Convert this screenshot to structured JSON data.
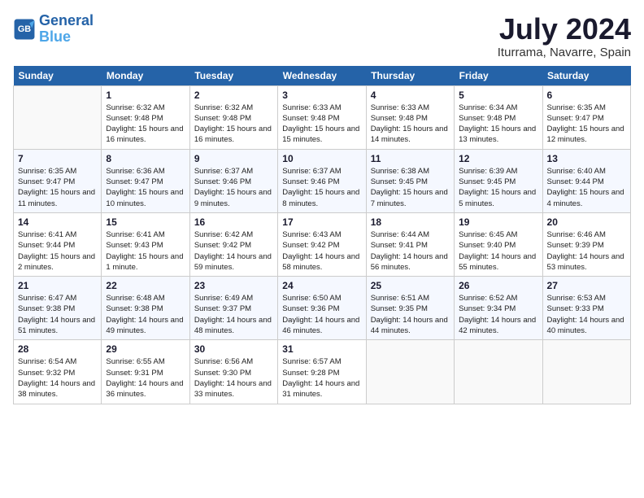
{
  "header": {
    "logo_line1": "General",
    "logo_line2": "Blue",
    "month": "July 2024",
    "location": "Iturrama, Navarre, Spain"
  },
  "days_of_week": [
    "Sunday",
    "Monday",
    "Tuesday",
    "Wednesday",
    "Thursday",
    "Friday",
    "Saturday"
  ],
  "weeks": [
    [
      {
        "date": "",
        "sunrise": "",
        "sunset": "",
        "daylight": ""
      },
      {
        "date": "1",
        "sunrise": "Sunrise: 6:32 AM",
        "sunset": "Sunset: 9:48 PM",
        "daylight": "Daylight: 15 hours and 16 minutes."
      },
      {
        "date": "2",
        "sunrise": "Sunrise: 6:32 AM",
        "sunset": "Sunset: 9:48 PM",
        "daylight": "Daylight: 15 hours and 16 minutes."
      },
      {
        "date": "3",
        "sunrise": "Sunrise: 6:33 AM",
        "sunset": "Sunset: 9:48 PM",
        "daylight": "Daylight: 15 hours and 15 minutes."
      },
      {
        "date": "4",
        "sunrise": "Sunrise: 6:33 AM",
        "sunset": "Sunset: 9:48 PM",
        "daylight": "Daylight: 15 hours and 14 minutes."
      },
      {
        "date": "5",
        "sunrise": "Sunrise: 6:34 AM",
        "sunset": "Sunset: 9:48 PM",
        "daylight": "Daylight: 15 hours and 13 minutes."
      },
      {
        "date": "6",
        "sunrise": "Sunrise: 6:35 AM",
        "sunset": "Sunset: 9:47 PM",
        "daylight": "Daylight: 15 hours and 12 minutes."
      }
    ],
    [
      {
        "date": "7",
        "sunrise": "Sunrise: 6:35 AM",
        "sunset": "Sunset: 9:47 PM",
        "daylight": "Daylight: 15 hours and 11 minutes."
      },
      {
        "date": "8",
        "sunrise": "Sunrise: 6:36 AM",
        "sunset": "Sunset: 9:47 PM",
        "daylight": "Daylight: 15 hours and 10 minutes."
      },
      {
        "date": "9",
        "sunrise": "Sunrise: 6:37 AM",
        "sunset": "Sunset: 9:46 PM",
        "daylight": "Daylight: 15 hours and 9 minutes."
      },
      {
        "date": "10",
        "sunrise": "Sunrise: 6:37 AM",
        "sunset": "Sunset: 9:46 PM",
        "daylight": "Daylight: 15 hours and 8 minutes."
      },
      {
        "date": "11",
        "sunrise": "Sunrise: 6:38 AM",
        "sunset": "Sunset: 9:45 PM",
        "daylight": "Daylight: 15 hours and 7 minutes."
      },
      {
        "date": "12",
        "sunrise": "Sunrise: 6:39 AM",
        "sunset": "Sunset: 9:45 PM",
        "daylight": "Daylight: 15 hours and 5 minutes."
      },
      {
        "date": "13",
        "sunrise": "Sunrise: 6:40 AM",
        "sunset": "Sunset: 9:44 PM",
        "daylight": "Daylight: 15 hours and 4 minutes."
      }
    ],
    [
      {
        "date": "14",
        "sunrise": "Sunrise: 6:41 AM",
        "sunset": "Sunset: 9:44 PM",
        "daylight": "Daylight: 15 hours and 2 minutes."
      },
      {
        "date": "15",
        "sunrise": "Sunrise: 6:41 AM",
        "sunset": "Sunset: 9:43 PM",
        "daylight": "Daylight: 15 hours and 1 minute."
      },
      {
        "date": "16",
        "sunrise": "Sunrise: 6:42 AM",
        "sunset": "Sunset: 9:42 PM",
        "daylight": "Daylight: 14 hours and 59 minutes."
      },
      {
        "date": "17",
        "sunrise": "Sunrise: 6:43 AM",
        "sunset": "Sunset: 9:42 PM",
        "daylight": "Daylight: 14 hours and 58 minutes."
      },
      {
        "date": "18",
        "sunrise": "Sunrise: 6:44 AM",
        "sunset": "Sunset: 9:41 PM",
        "daylight": "Daylight: 14 hours and 56 minutes."
      },
      {
        "date": "19",
        "sunrise": "Sunrise: 6:45 AM",
        "sunset": "Sunset: 9:40 PM",
        "daylight": "Daylight: 14 hours and 55 minutes."
      },
      {
        "date": "20",
        "sunrise": "Sunrise: 6:46 AM",
        "sunset": "Sunset: 9:39 PM",
        "daylight": "Daylight: 14 hours and 53 minutes."
      }
    ],
    [
      {
        "date": "21",
        "sunrise": "Sunrise: 6:47 AM",
        "sunset": "Sunset: 9:38 PM",
        "daylight": "Daylight: 14 hours and 51 minutes."
      },
      {
        "date": "22",
        "sunrise": "Sunrise: 6:48 AM",
        "sunset": "Sunset: 9:38 PM",
        "daylight": "Daylight: 14 hours and 49 minutes."
      },
      {
        "date": "23",
        "sunrise": "Sunrise: 6:49 AM",
        "sunset": "Sunset: 9:37 PM",
        "daylight": "Daylight: 14 hours and 48 minutes."
      },
      {
        "date": "24",
        "sunrise": "Sunrise: 6:50 AM",
        "sunset": "Sunset: 9:36 PM",
        "daylight": "Daylight: 14 hours and 46 minutes."
      },
      {
        "date": "25",
        "sunrise": "Sunrise: 6:51 AM",
        "sunset": "Sunset: 9:35 PM",
        "daylight": "Daylight: 14 hours and 44 minutes."
      },
      {
        "date": "26",
        "sunrise": "Sunrise: 6:52 AM",
        "sunset": "Sunset: 9:34 PM",
        "daylight": "Daylight: 14 hours and 42 minutes."
      },
      {
        "date": "27",
        "sunrise": "Sunrise: 6:53 AM",
        "sunset": "Sunset: 9:33 PM",
        "daylight": "Daylight: 14 hours and 40 minutes."
      }
    ],
    [
      {
        "date": "28",
        "sunrise": "Sunrise: 6:54 AM",
        "sunset": "Sunset: 9:32 PM",
        "daylight": "Daylight: 14 hours and 38 minutes."
      },
      {
        "date": "29",
        "sunrise": "Sunrise: 6:55 AM",
        "sunset": "Sunset: 9:31 PM",
        "daylight": "Daylight: 14 hours and 36 minutes."
      },
      {
        "date": "30",
        "sunrise": "Sunrise: 6:56 AM",
        "sunset": "Sunset: 9:30 PM",
        "daylight": "Daylight: 14 hours and 33 minutes."
      },
      {
        "date": "31",
        "sunrise": "Sunrise: 6:57 AM",
        "sunset": "Sunset: 9:28 PM",
        "daylight": "Daylight: 14 hours and 31 minutes."
      },
      {
        "date": "",
        "sunrise": "",
        "sunset": "",
        "daylight": ""
      },
      {
        "date": "",
        "sunrise": "",
        "sunset": "",
        "daylight": ""
      },
      {
        "date": "",
        "sunrise": "",
        "sunset": "",
        "daylight": ""
      }
    ]
  ]
}
